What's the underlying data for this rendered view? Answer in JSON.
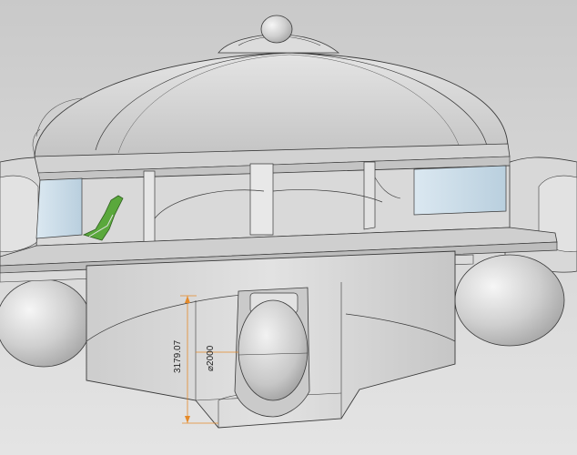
{
  "viewport": {
    "background_color": "#d3d3d3",
    "model_color": "#d6d6d6",
    "edge_color": "#3a3a3a",
    "glass_color": "#cfe0ec",
    "seat_color": "#5aa83c",
    "dimension_color": "#e58a2a"
  },
  "dimensions": {
    "height_label": "3179.07",
    "diameter_label": "⌀2000"
  }
}
